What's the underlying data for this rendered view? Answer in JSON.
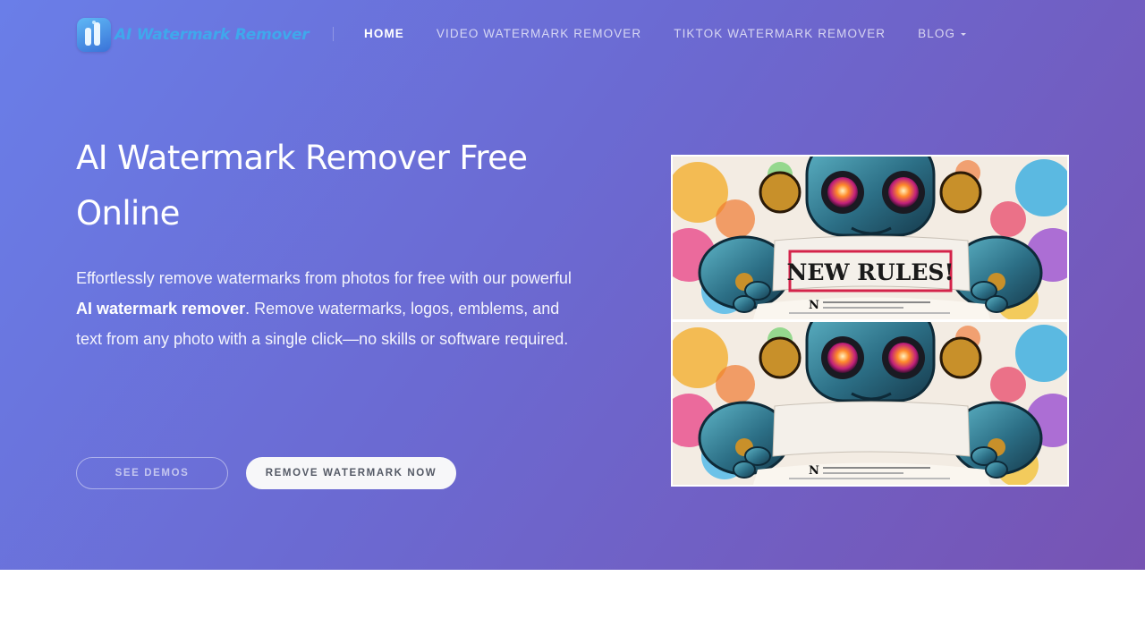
{
  "header": {
    "logo_text": "AI Watermark Remover",
    "logo_icon": "logo-icon",
    "nav": [
      {
        "label": "HOME",
        "active": true
      },
      {
        "label": "VIDEO WATERMARK REMOVER",
        "active": false
      },
      {
        "label": "TIKTOK WATERMARK REMOVER",
        "active": false
      },
      {
        "label": "BLOG",
        "active": false,
        "has_dropdown": true
      }
    ]
  },
  "hero": {
    "title": "AI Watermark Remover Free Online",
    "description_before": "Effortlessly remove watermarks from photos for free with our powerful ",
    "description_bold": "AI watermark remover",
    "description_after": ". Remove watermarks, logos, emblems, and text from any photo with a single click—no skills or software required.",
    "buttons": {
      "see_demos": "SEE DEMOS",
      "remove_now": "REMOVE WATERMARK NOW"
    }
  },
  "demo_image": {
    "before_sign_text": "NEW RULES!",
    "paper_letter": "N"
  },
  "colors": {
    "gradient_start": "#6a7ee8",
    "gradient_end": "#7753b3",
    "logo_text": "#3fa8ec",
    "button_light_bg": "#f7f7f9"
  }
}
